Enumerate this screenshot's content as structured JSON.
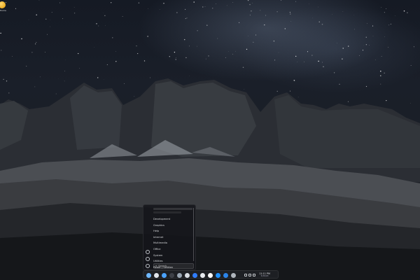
{
  "desktop": {
    "icon_name": "folder-icon",
    "icon_label": "Home"
  },
  "launcher": {
    "categories": [
      "Development",
      "Graphics",
      "Help",
      "Internet",
      "Multimedia",
      "Office",
      "System",
      "Utilities",
      "Power / Session"
    ],
    "search": {
      "placeholder": "Search..."
    },
    "rail_icons": [
      "user-icon",
      "settings-icon",
      "power-icon"
    ]
  },
  "dock": {
    "apps": [
      {
        "name": "launcher-icon",
        "color": "#6fb8ff"
      },
      {
        "name": "browser-icon",
        "color": "#e0e4ea"
      },
      {
        "name": "file-manager-icon",
        "color": "#4aa3ff"
      },
      {
        "name": "terminal-icon",
        "color": "#3d4046"
      },
      {
        "name": "settings-icon",
        "color": "#9aa6b2"
      },
      {
        "name": "store-icon",
        "color": "#d8dde3"
      },
      {
        "name": "music-icon",
        "color": "#2f7dff"
      },
      {
        "name": "mail-icon",
        "color": "#e7eaee"
      },
      {
        "name": "calendar-icon",
        "color": "#ffffff"
      },
      {
        "name": "photos-icon",
        "color": "#1e90ff"
      },
      {
        "name": "video-icon",
        "color": "#2b84e8"
      },
      {
        "name": "trash-icon",
        "color": "#b0b6bd"
      }
    ],
    "clock": {
      "time": "11:11 PM",
      "date": "5/26/20"
    },
    "tray": [
      "network-icon",
      "volume-icon",
      "notification-icon"
    ]
  }
}
